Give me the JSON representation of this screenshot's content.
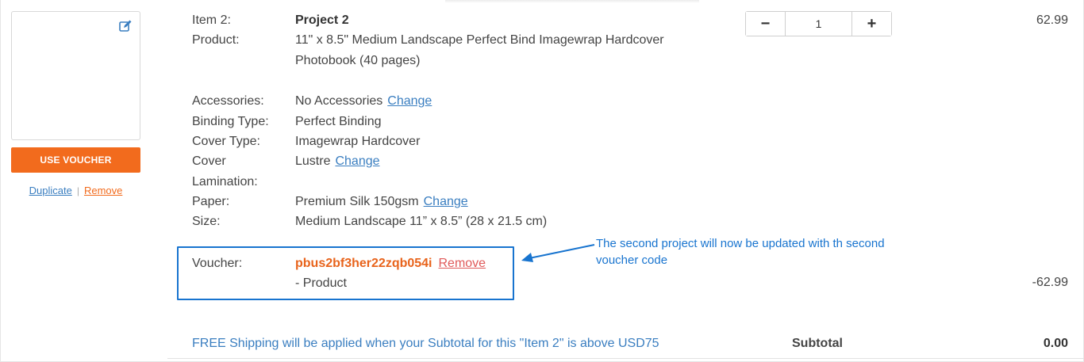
{
  "item": {
    "label": "Item 2:",
    "name": "Project 2",
    "product_label": "Product:",
    "product_line1": "11\" x 8.5\" Medium Landscape Perfect Bind Imagewrap Hardcover",
    "product_line2": "Photobook (40 pages)",
    "price": "62.99"
  },
  "left": {
    "use_voucher_label": "USE VOUCHER",
    "duplicate_label": "Duplicate",
    "separator": "|",
    "remove_label": "Remove"
  },
  "details": {
    "accessories_label": "Accessories:",
    "accessories_value": "No Accessories",
    "binding_label": "Binding Type:",
    "binding_value": "Perfect Binding",
    "cover_type_label": "Cover Type:",
    "cover_type_value": "Imagewrap Hardcover",
    "lamination_label_1": "Cover",
    "lamination_label_2": "Lamination:",
    "lamination_value": "Lustre",
    "paper_label": "Paper:",
    "paper_value": "Premium Silk 150gsm",
    "size_label": "Size:",
    "size_value": "Medium Landscape 11” x 8.5” (28 x 21.5 cm)",
    "change_label": "Change"
  },
  "quantity": {
    "minus": "−",
    "value": "1",
    "plus": "+"
  },
  "voucher": {
    "label": "Voucher:",
    "code": "pbus2bf3her22zqb054i",
    "remove_label": "Remove",
    "type": "- Product",
    "discount": "-62.99"
  },
  "annotation": {
    "text": "The second project will now be updated with th second voucher code",
    "color": "#1874cf"
  },
  "footer": {
    "shipping_text": "FREE Shipping will be applied when your Subtotal for this \"Item 2\" is above USD75",
    "subtotal_label": "Subtotal",
    "subtotal_value": "0.00"
  },
  "colors": {
    "accent_orange": "#f26b1d",
    "link_blue": "#3a7ec0"
  }
}
